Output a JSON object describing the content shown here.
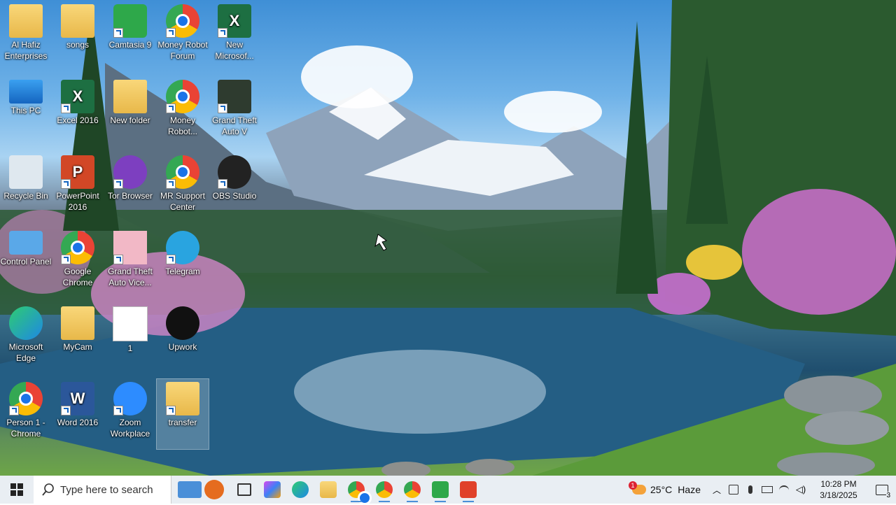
{
  "desktop_icons": [
    {
      "name": "al-hafiz-icon",
      "label": "Al Hafiz Enterprises",
      "type": "folder"
    },
    {
      "name": "songs-icon",
      "label": "songs",
      "type": "folder"
    },
    {
      "name": "camtasia-icon",
      "label": "Camtasia 9",
      "type": "camtasia"
    },
    {
      "name": "money-robot-forum-icon",
      "label": "Money Robot Forum",
      "type": "chrome"
    },
    {
      "name": "new-excel-icon",
      "label": "New Microsof...",
      "type": "excel"
    },
    {
      "name": "this-pc-icon",
      "label": "This PC",
      "type": "pc"
    },
    {
      "name": "excel-2016-icon",
      "label": "Excel 2016",
      "type": "excel"
    },
    {
      "name": "new-folder-icon",
      "label": "New folder",
      "type": "folder"
    },
    {
      "name": "money-robot-icon",
      "label": "Money Robot...",
      "type": "chrome"
    },
    {
      "name": "gta-v-icon",
      "label": "Grand Theft Auto V",
      "type": "gta"
    },
    {
      "name": "recycle-bin-icon",
      "label": "Recycle Bin",
      "type": "recycle"
    },
    {
      "name": "powerpoint-icon",
      "label": "PowerPoint 2016",
      "type": "ppt"
    },
    {
      "name": "tor-browser-icon",
      "label": "Tor Browser",
      "type": "tor"
    },
    {
      "name": "mr-support-icon",
      "label": "MR Support Center",
      "type": "chrome"
    },
    {
      "name": "obs-studio-icon",
      "label": "OBS Studio",
      "type": "obs"
    },
    {
      "name": "control-panel-icon",
      "label": "Control Panel",
      "type": "cp"
    },
    {
      "name": "google-chrome-icon",
      "label": "Google Chrome",
      "type": "chrome"
    },
    {
      "name": "gta-vice-icon",
      "label": "Grand Theft Auto Vice...",
      "type": "gtavc"
    },
    {
      "name": "telegram-icon",
      "label": "Telegram",
      "type": "telegram"
    },
    {
      "name": "edge-icon",
      "label": "Microsoft Edge",
      "type": "edge"
    },
    {
      "name": "mycam-icon",
      "label": "MyCam",
      "type": "folder"
    },
    {
      "name": "file-1-icon",
      "label": "1",
      "type": "doc"
    },
    {
      "name": "upwork-icon",
      "label": "Upwork",
      "type": "upwork"
    },
    {
      "name": "person1-chrome-icon",
      "label": "Person 1 - Chrome",
      "type": "chrome"
    },
    {
      "name": "word-2016-icon",
      "label": "Word 2016",
      "type": "word"
    },
    {
      "name": "zoom-icon",
      "label": "Zoom Workplace",
      "type": "zoom"
    },
    {
      "name": "transfer-icon",
      "label": "transfer",
      "type": "folder"
    }
  ],
  "taskbar": {
    "search_placeholder": "Type here to search",
    "weather_temp": "25°C",
    "weather_desc": "Haze",
    "weather_badge": "1",
    "time": "10:28 PM",
    "date": "3/18/2025",
    "notification_count": "3"
  },
  "colors": {
    "taskbar_bg": "#e9eef3",
    "accent": "#4a8fd8"
  }
}
